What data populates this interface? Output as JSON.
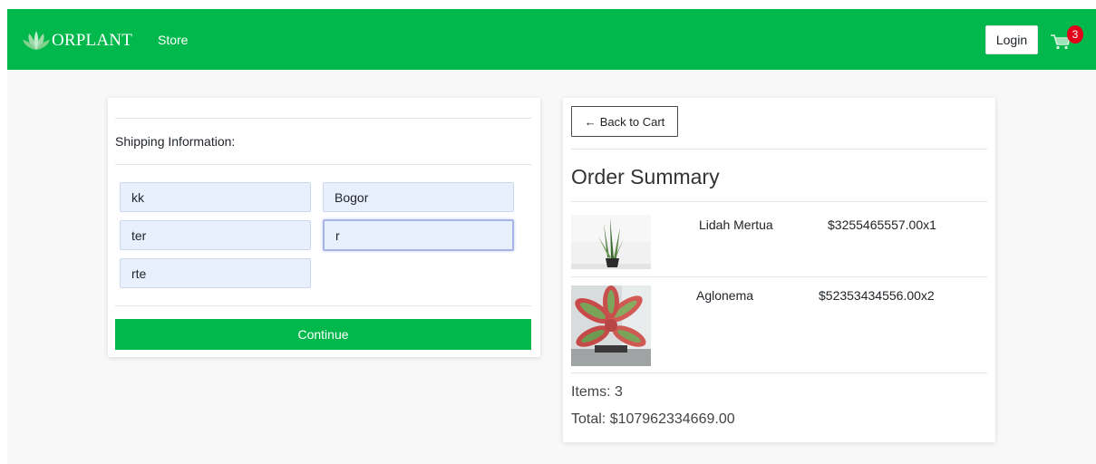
{
  "navbar": {
    "brand_text": "ORPLANT",
    "store_label": "Store",
    "login_label": "Login",
    "cart_count": "3",
    "colors": {
      "navbar_bg": "#00b84c",
      "badge_bg": "#e3001b"
    }
  },
  "shipping": {
    "heading": "Shipping Information:",
    "fields": [
      {
        "value": "kk"
      },
      {
        "value": "Bogor"
      },
      {
        "value": "ter"
      },
      {
        "value": "r"
      },
      {
        "value": "rte"
      }
    ],
    "continue_label": "Continue"
  },
  "summary": {
    "back_label": "Back to Cart",
    "back_arrow": "←",
    "title": "Order Summary",
    "items": [
      {
        "name": "Lidah Mertua",
        "price": "$3255465557.00x1",
        "image_icon": "snake-plant-image"
      },
      {
        "name": "Aglonema",
        "price": "$52353434556.00x2",
        "image_icon": "aglonema-plant-image"
      }
    ],
    "items_count": "Items: 3",
    "total": "Total: $107962334669.00"
  }
}
